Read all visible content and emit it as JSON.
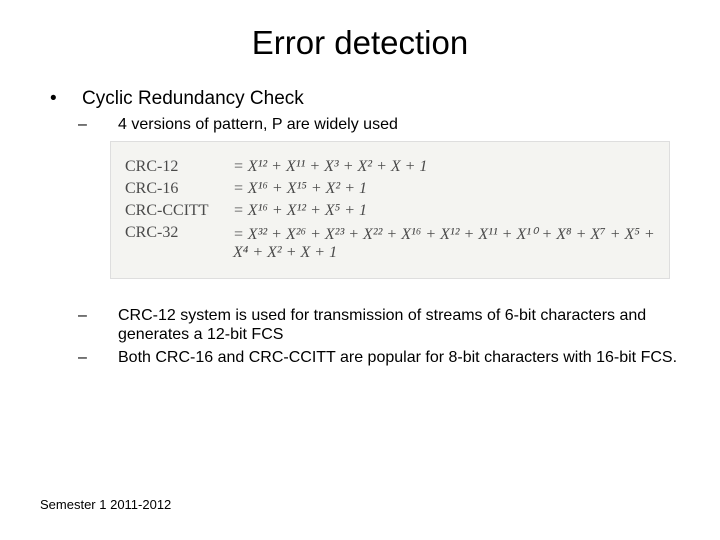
{
  "title": "Error detection",
  "bullets": {
    "main": "Cyclic Redundancy Check",
    "sub1": "4 versions of pattern, P are widely used",
    "sub2": "CRC-12 system is used for transmission of streams of 6-bit characters and generates a 12-bit FCS",
    "sub3": "Both CRC-16 and CRC-CCITT are popular for 8-bit characters with 16-bit FCS."
  },
  "formulas": {
    "rows": [
      {
        "name": "CRC-12",
        "poly": "X¹² + X¹¹ + X³ + X² + X + 1"
      },
      {
        "name": "CRC-16",
        "poly": "X¹⁶ + X¹⁵ + X² + 1"
      },
      {
        "name": "CRC-CCITT",
        "poly": "X¹⁶ + X¹² + X⁵ + 1"
      },
      {
        "name": "CRC-32",
        "poly": "X³² + X²⁶ + X²³ + X²² + X¹⁶ + X¹² + X¹¹ + X¹⁰ + X⁸ + X⁷ + X⁵ + X⁴ + X² + X + 1"
      }
    ]
  },
  "footer": "Semester 1 2011-2012"
}
